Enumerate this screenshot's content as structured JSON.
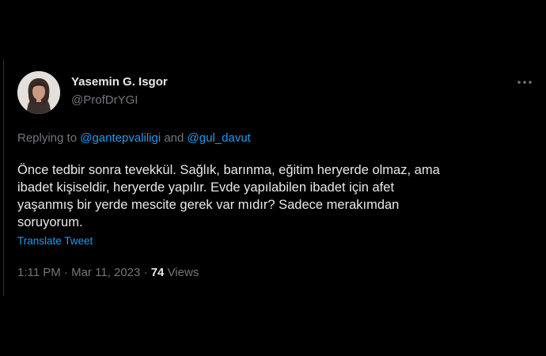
{
  "tweet": {
    "author": {
      "display_name": "Yasemin G. Isgor",
      "handle": "@ProfDrYGI"
    },
    "more_icon": "more-horizontal-icon",
    "reply_context": {
      "prefix": "Replying to ",
      "mention_1": "@gantepvaliligi",
      "joiner": " and ",
      "mention_2": "@gul_davut"
    },
    "text_lines": [
      "Önce tedbir sonra tevekkül. Sağlık, barınma, eğitim heryerde olmaz, ama",
      "ibadet kişiseldir, heryerde yapılır. Evde yapılabilen ibadet için afet",
      "yaşanmış bir yerde mescite gerek var mıdır?  Sadece merakımdan",
      "soruyorum."
    ],
    "translate_label": "Translate Tweet",
    "meta": {
      "time": "1:11 PM",
      "separator_1": " · ",
      "date": "Mar 11, 2023",
      "separator_2": " · ",
      "views_count": "74",
      "views_label": " Views"
    }
  },
  "colors": {
    "background": "#000000",
    "primary_text": "#e7e9ea",
    "secondary_text": "#71767b",
    "accent": "#1d9bf0",
    "border": "#2f3336"
  }
}
